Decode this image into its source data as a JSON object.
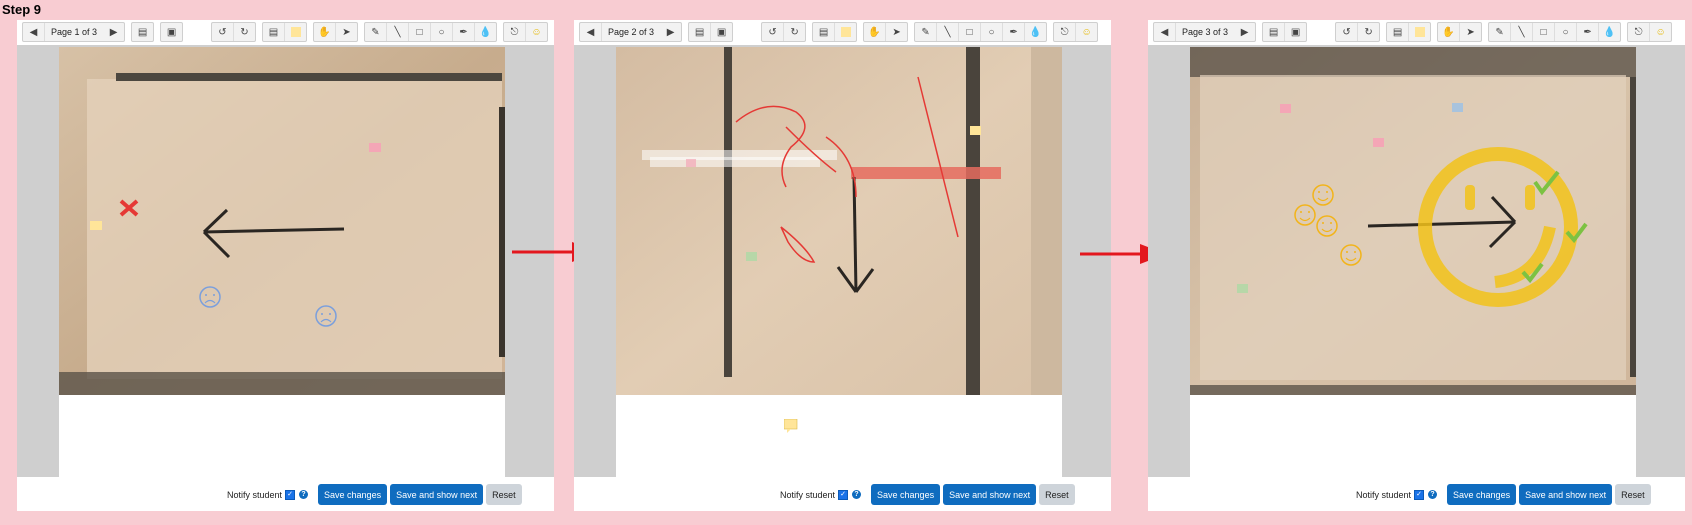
{
  "step_title": "Step 9",
  "panels": [
    {
      "page_label": "Page 1 of 3"
    },
    {
      "page_label": "Page 2 of 3"
    },
    {
      "page_label": "Page 3 of 3"
    }
  ],
  "footer": {
    "notify_label": "Notify student",
    "save_label": "Save changes",
    "save_next_label": "Save and show next",
    "reset_label": "Reset"
  },
  "colors": {
    "background": "#f8ccd2",
    "primary": "#0f6cbf",
    "arrow": "#e3171e",
    "yellow_highlight": "#ffe599"
  }
}
